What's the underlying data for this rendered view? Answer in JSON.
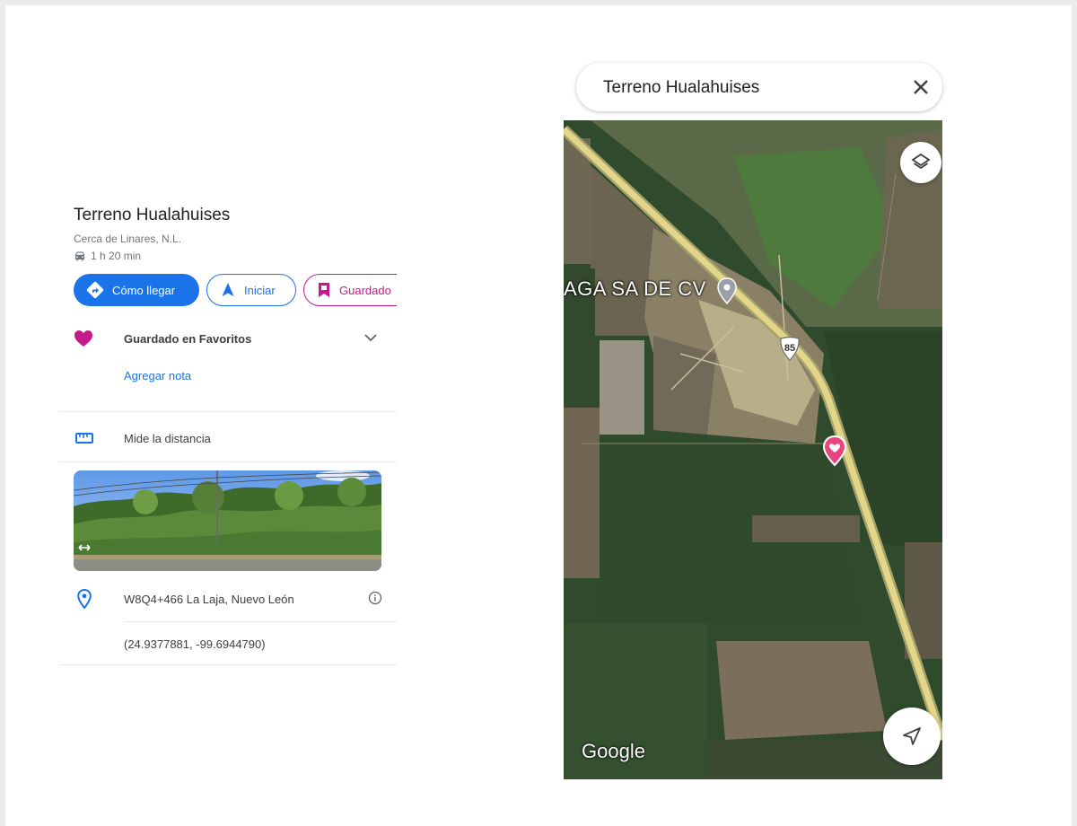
{
  "place": {
    "title": "Terreno Hualahuises",
    "subtitle": "Cerca de Linares, N.L.",
    "travel_time": "1 h 20 min"
  },
  "actions": {
    "directions_label": "Cómo llegar",
    "start_label": "Iniciar",
    "saved_label": "Guardado"
  },
  "saved_list": {
    "label": "Guardado en Favoritos",
    "add_note": "Agregar nota"
  },
  "measure": {
    "label": "Mide la distancia"
  },
  "address": {
    "plus_code": "W8Q4+466 La Laja, Nuevo León",
    "coordinates": "(24.9377881, -99.6944790)"
  },
  "search": {
    "value": "Terreno Hualahuises"
  },
  "map": {
    "business_label": "AGA SA DE CV",
    "route_number": "85",
    "attribution": "Google"
  },
  "icons": {
    "car": "car-icon",
    "directions": "directions-icon",
    "navigate": "navigation-arrow-icon",
    "bookmark": "bookmark-icon",
    "heart": "heart-icon",
    "chevron": "chevron-down-icon",
    "ruler": "ruler-icon",
    "pin": "location-pin-icon",
    "info": "info-icon",
    "close": "close-icon",
    "layers": "layers-icon",
    "locate": "my-location-arrow-icon",
    "map_pin": "saved-place-pin-icon",
    "grey_pin": "poi-pin-icon",
    "pan": "pan-360-icon"
  },
  "colors": {
    "primary_blue": "#1a73e8",
    "saved_pink": "#c51b8a",
    "text_dark": "#202124",
    "text_grey": "#70757a"
  }
}
